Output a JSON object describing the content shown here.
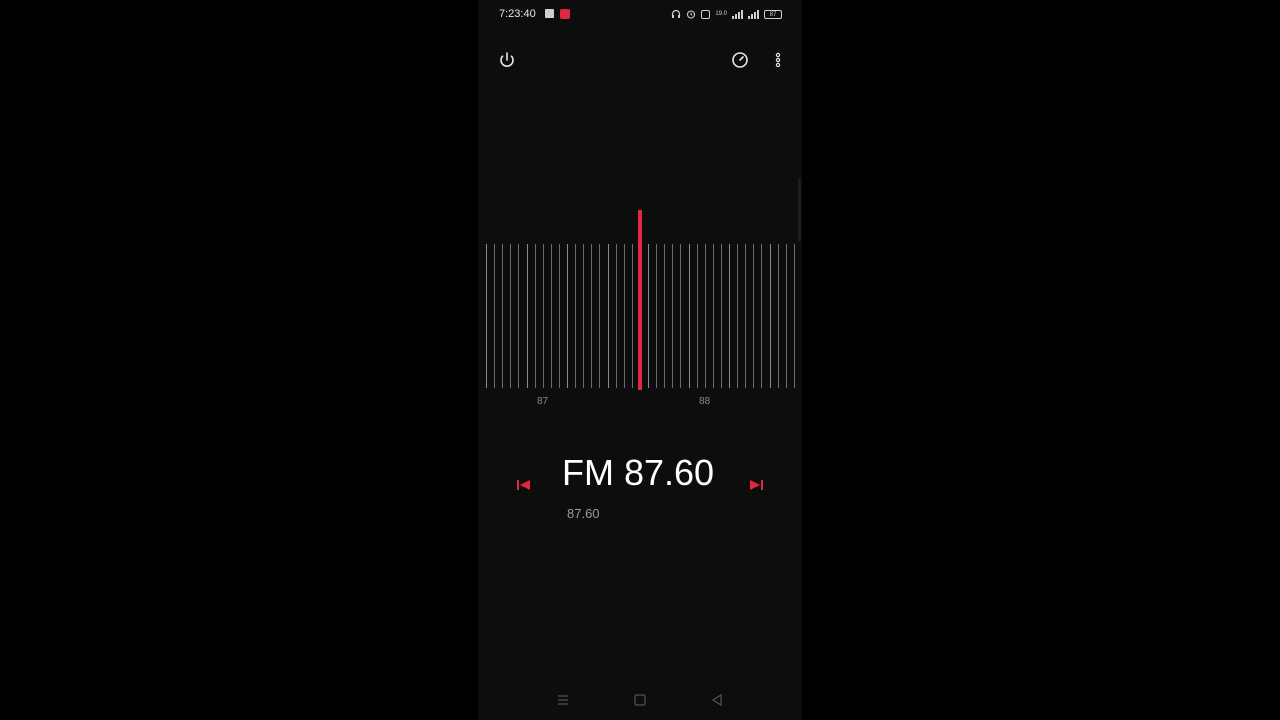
{
  "status_bar": {
    "time": "7:23:40",
    "network_speed": "19.0",
    "battery": "87"
  },
  "toolbar": {
    "power_icon": "power-icon",
    "sleep_timer_icon": "timer-icon",
    "more_icon": "more-vertical-icon"
  },
  "tuner": {
    "scale_labels": [
      "87",
      "88"
    ],
    "accent_color": "#e0283e"
  },
  "station": {
    "band_frequency": "FM 87.60",
    "frequency_subtext": "87.60",
    "prev_icon": "skip-previous-icon",
    "next_icon": "skip-next-icon"
  },
  "navigation": {
    "menu_icon": "menu-icon",
    "home_icon": "home-icon",
    "back_icon": "back-icon"
  }
}
